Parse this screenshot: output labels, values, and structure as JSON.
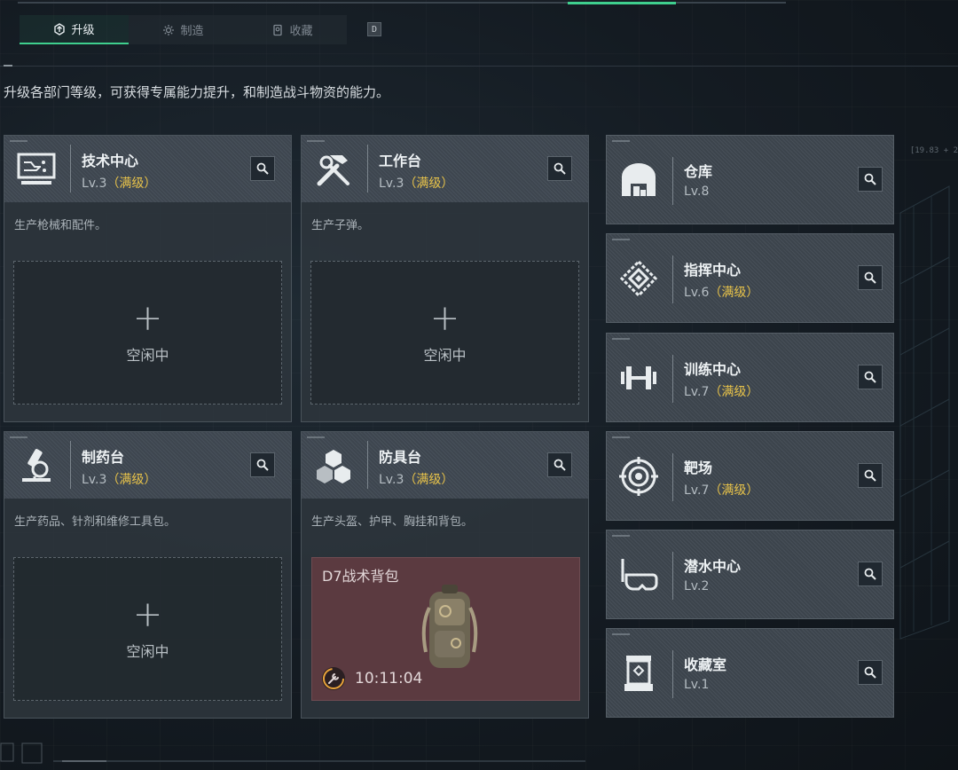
{
  "tabs": [
    {
      "label": "升级",
      "icon": "upgrade-icon",
      "active": true
    },
    {
      "label": "制造",
      "icon": "gear-icon",
      "active": false
    },
    {
      "label": "收藏",
      "icon": "collection-icon",
      "active": false
    }
  ],
  "tab_key": "D",
  "description": "升级各部门等级，可获得专属能力提升，和制造战斗物资的能力。",
  "hud": "[19.83 + 2",
  "colors": {
    "accent": "#3fcf8e",
    "max_level": "#e8c34a",
    "crafting": "#5b3a40"
  },
  "facilities": [
    {
      "name": "技术中心",
      "level": "Lv.3",
      "max": "（满级）",
      "desc": "生产枪械和配件。",
      "icon": "computer-icon",
      "slot": "空闲中"
    },
    {
      "name": "工作台",
      "level": "Lv.3",
      "max": "（满级）",
      "desc": "生产子弹。",
      "icon": "hammer-wrench-icon",
      "slot": "空闲中"
    },
    {
      "name": "制药台",
      "level": "Lv.3",
      "max": "（满级）",
      "desc": "生产药品、针剂和维修工具包。",
      "icon": "microscope-icon",
      "slot": "空闲中"
    },
    {
      "name": "防具台",
      "level": "Lv.3",
      "max": "（满级）",
      "desc": "生产头盔、护甲、胸挂和背包。",
      "icon": "cubes-icon",
      "crafting": {
        "item": "D7战术背包",
        "time": "10:11:04",
        "item_icon": "backpack-icon"
      }
    }
  ],
  "side_facilities": [
    {
      "name": "仓库",
      "level": "Lv.8",
      "max": "",
      "icon": "warehouse-icon"
    },
    {
      "name": "指挥中心",
      "level": "Lv.6",
      "max": "（满级）",
      "icon": "command-icon"
    },
    {
      "name": "训练中心",
      "level": "Lv.7",
      "max": "（满级）",
      "icon": "dumbbell-icon"
    },
    {
      "name": "靶场",
      "level": "Lv.7",
      "max": "（满级）",
      "icon": "target-icon"
    },
    {
      "name": "潜水中心",
      "level": "Lv.2",
      "max": "",
      "icon": "diving-mask-icon"
    },
    {
      "name": "收藏室",
      "level": "Lv.1",
      "max": "",
      "icon": "display-case-icon"
    }
  ]
}
